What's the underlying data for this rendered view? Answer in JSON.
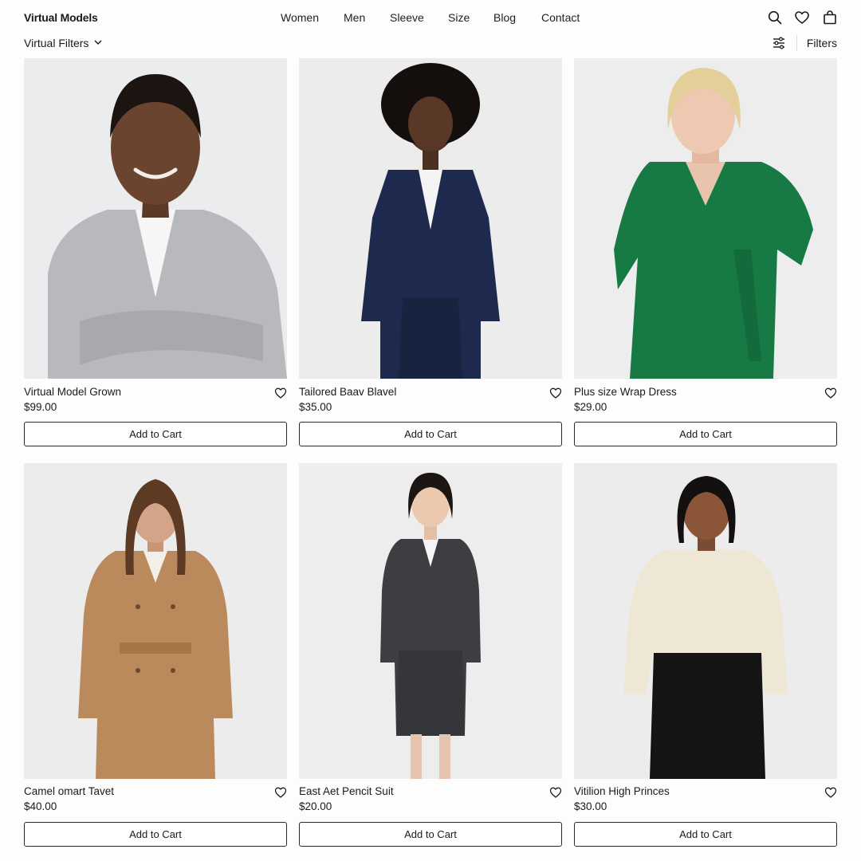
{
  "header": {
    "brand": "Virtual Models",
    "nav": [
      "Women",
      "Men",
      "Sleeve",
      "Size",
      "Blog",
      "Contact"
    ],
    "icons": [
      "search-icon",
      "heart-icon",
      "shopping-bag-icon"
    ]
  },
  "subbar": {
    "virtual_filters_label": "Virtual Filters",
    "filters_label": "Filters"
  },
  "products": [
    {
      "name": "Virtual Model Grown",
      "price": "$99.00",
      "cta": "Add to Cart",
      "garment_color": "#b7b9bd"
    },
    {
      "name": "Tailored Baav Blavel",
      "price": "$35.00",
      "cta": "Add to Cart",
      "garment_color": "#1d2a4e"
    },
    {
      "name": "Plus size Wrap Dress",
      "price": "$29.00",
      "cta": "Add to Cart",
      "garment_color": "#177a45"
    },
    {
      "name": "Camel omart Tavet",
      "price": "$40.00",
      "cta": "Add to Cart",
      "garment_color": "#bb8a5c"
    },
    {
      "name": "East Aet Pencit Suit",
      "price": "$20.00",
      "cta": "Add to Cart",
      "garment_color": "#3c3e42"
    },
    {
      "name": "Vitilion High Princes",
      "price": "$30.00",
      "cta": "Add to Cart",
      "garment_color": "#efe7d6"
    }
  ],
  "colors": {
    "photo_background": "#eeeeee",
    "button_border": "#2a2a2a"
  }
}
